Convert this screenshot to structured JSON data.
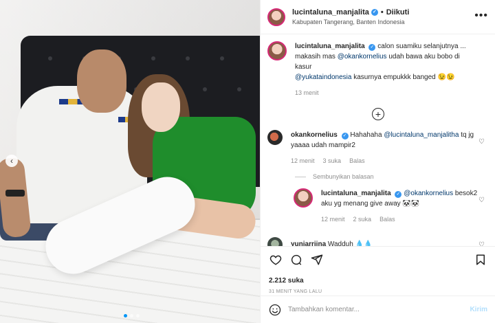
{
  "header": {
    "username": "lucintaluna_manjalita",
    "separator": "•",
    "follow_label": "Diikuti",
    "location": "Kabupaten Tangerang, Banten Indonesia"
  },
  "caption": {
    "username": "lucintaluna_manjalita",
    "text_1": "calon suamiku selanjutnya ...",
    "text_2": "makasih mas ",
    "mention_1": "@okankornelius",
    "text_3": " udah bawa aku bobo di kasur ",
    "mention_2": "@yukataindonesia",
    "text_4": " kasurnya empukkk banged 😉😉",
    "time": "13 menit"
  },
  "comments": [
    {
      "username": "okankornelius",
      "mention": "@lucintaluna_manjalitha",
      "text": " tq jg yaaaa udah mampir2",
      "prefix": "Hahahaha ",
      "time": "12 menit",
      "likes": "3 suka",
      "reply_label": "Balas"
    },
    {
      "username": "lucintaluna_manjalita",
      "mention": "@okankornelius",
      "text": " besok2 aku yg menang give away 🐼🐼",
      "time": "12 menit",
      "likes": "2 suka",
      "reply_label": "Balas"
    },
    {
      "username": "yuniarriina",
      "text": "Wadduh 💧💧"
    }
  ],
  "hide_replies_label": "Sembunyikan balasan",
  "post": {
    "likes": "2.212 suka",
    "time_ago": "31 MENIT YANG LALU"
  },
  "add_comment": {
    "placeholder": "Tambahkan komentar...",
    "send_label": "Kirim"
  },
  "colors": {
    "verified": "#3897f0",
    "mention": "#00376b",
    "send_disabled": "#b2dffc",
    "dress": "#1f8d2c"
  }
}
